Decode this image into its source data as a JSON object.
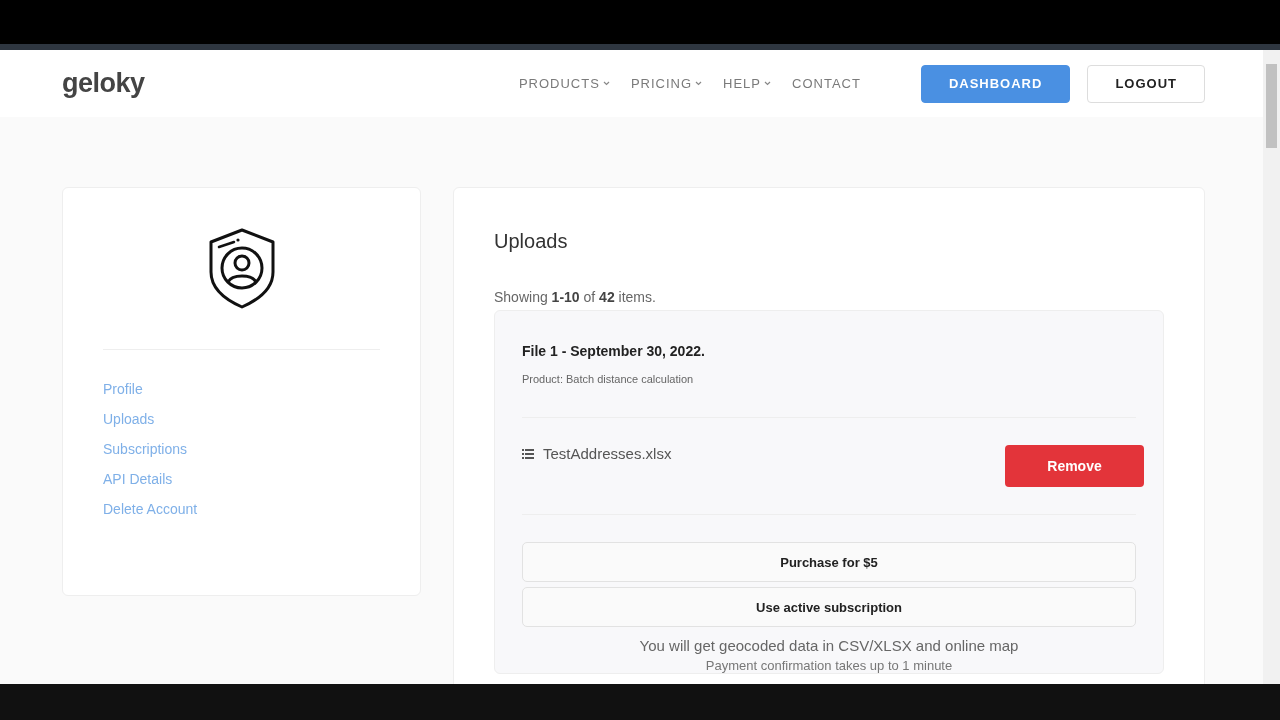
{
  "header": {
    "logo": "geloky",
    "nav": [
      {
        "label": "PRODUCTS",
        "dropdown": true
      },
      {
        "label": "PRICING",
        "dropdown": true
      },
      {
        "label": "HELP",
        "dropdown": true
      },
      {
        "label": "CONTACT",
        "dropdown": false
      }
    ],
    "buttons": [
      {
        "label": "DASHBOARD",
        "kind": "primary"
      },
      {
        "label": "LOGOUT",
        "kind": "outline"
      }
    ]
  },
  "sidebar": {
    "items": [
      "Profile",
      "Uploads",
      "Subscriptions",
      "API Details",
      "Delete Account"
    ]
  },
  "main": {
    "title": "Uploads",
    "summary": "Showing **1-10** of **42** items.",
    "upload": {
      "title": "File 1 - September 30, 2022.",
      "product": "Product: Batch distance calculation",
      "file": "TestAddresses.xlsx",
      "remove": "Remove",
      "actions": [
        "Purchase for $5",
        "Use active subscription"
      ],
      "note": "You will get geocoded data in CSV/XLSX and online map",
      "note_2": "Payment confirmation takes up to 1 minute"
    }
  }
}
